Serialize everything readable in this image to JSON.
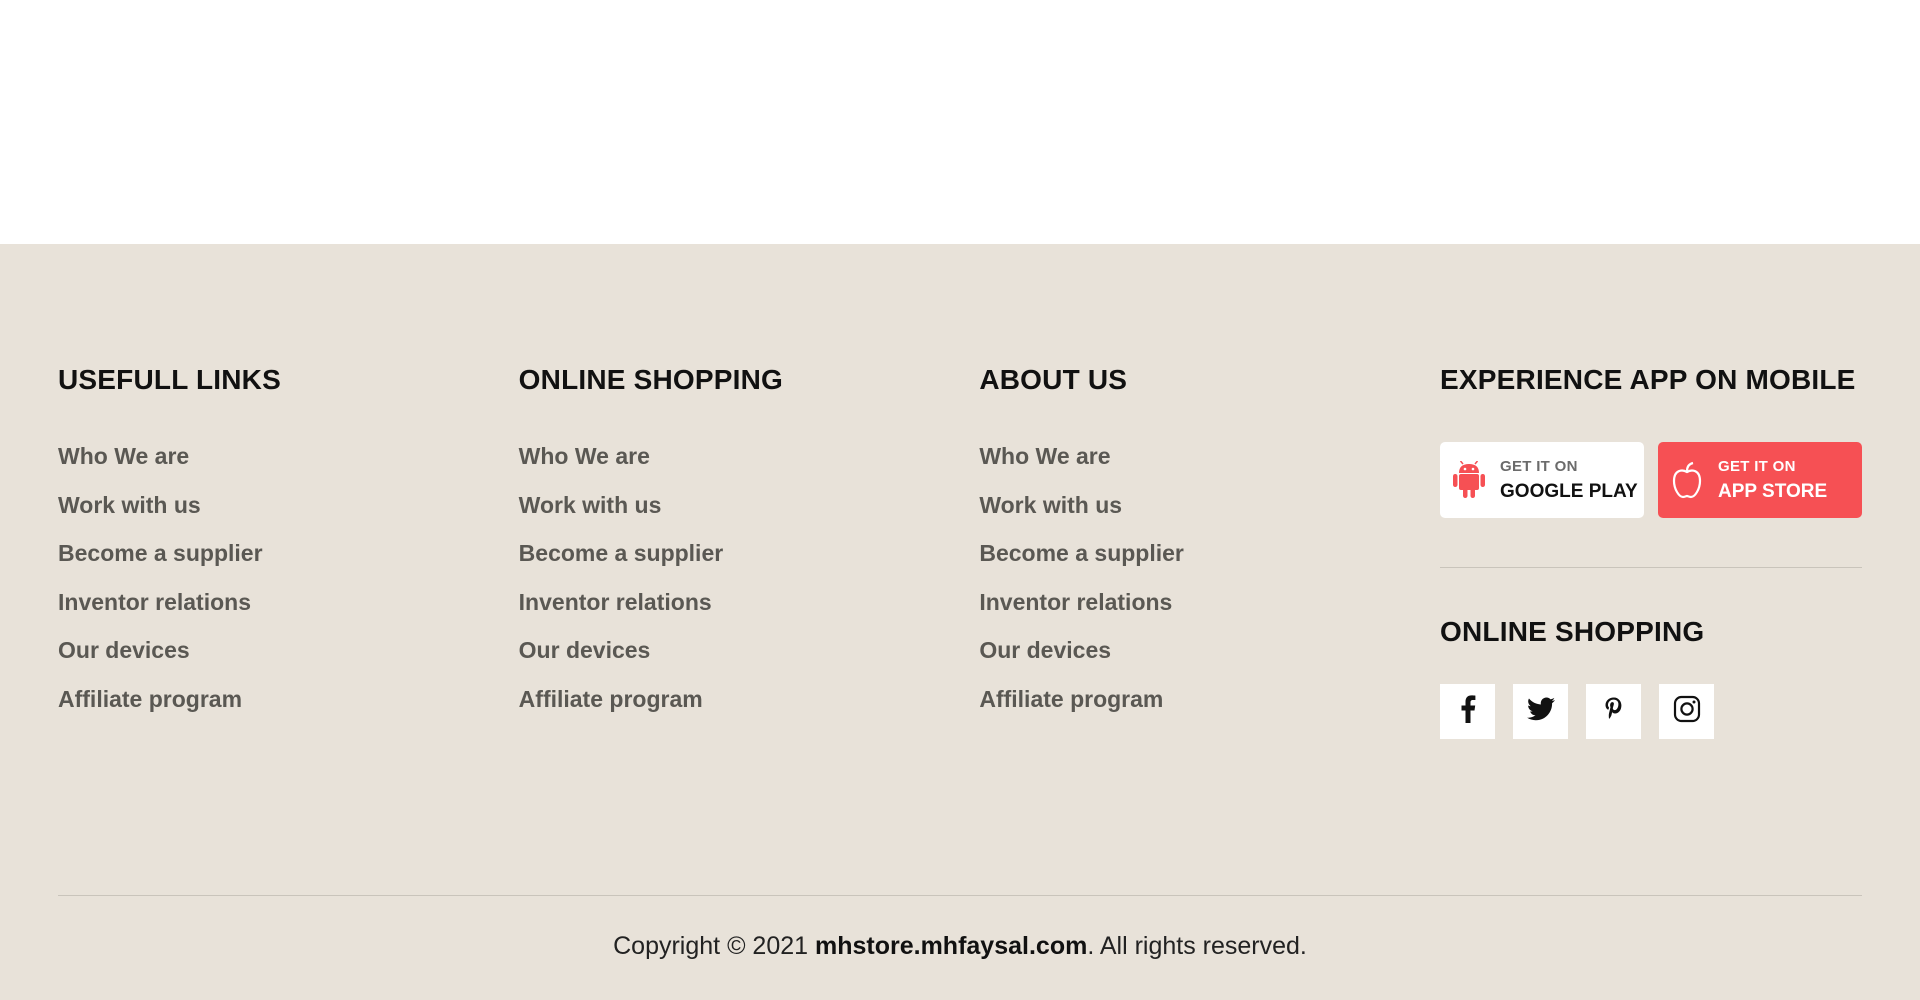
{
  "columns": [
    {
      "title": "USEFULL LINKS",
      "links": [
        "Who We are",
        "Work with us",
        "Become a supplier",
        "Inventor relations",
        "Our devices",
        "Affiliate program"
      ]
    },
    {
      "title": "ONLINE SHOPPING",
      "links": [
        "Who We are",
        "Work with us",
        "Become a supplier",
        "Inventor relations",
        "Our devices",
        "Affiliate program"
      ]
    },
    {
      "title": "ABOUT US",
      "links": [
        "Who We are",
        "Work with us",
        "Become a supplier",
        "Inventor relations",
        "Our devices",
        "Affiliate program"
      ]
    }
  ],
  "mobile": {
    "title": "EXPERIENCE APP ON MOBILE",
    "google": {
      "small": "GET IT ON",
      "big": "GOOGLE PLAY",
      "icon": "android-icon"
    },
    "apple": {
      "small": "GET IT ON",
      "big": "APP STORE",
      "icon": "apple-icon"
    }
  },
  "social": {
    "title": "ONLINE SHOPPING",
    "icons": [
      "facebook-icon",
      "twitter-icon",
      "pinterest-icon",
      "instagram-icon"
    ]
  },
  "copyright": {
    "prefix": "Copyright © 2021 ",
    "site": "mhstore.mhfaysal.com",
    "suffix": ". All rights reserved."
  },
  "colors": {
    "footer_bg": "#e8e2d9",
    "accent": "#f65054",
    "link": "#5a5853",
    "heading": "#111111"
  }
}
